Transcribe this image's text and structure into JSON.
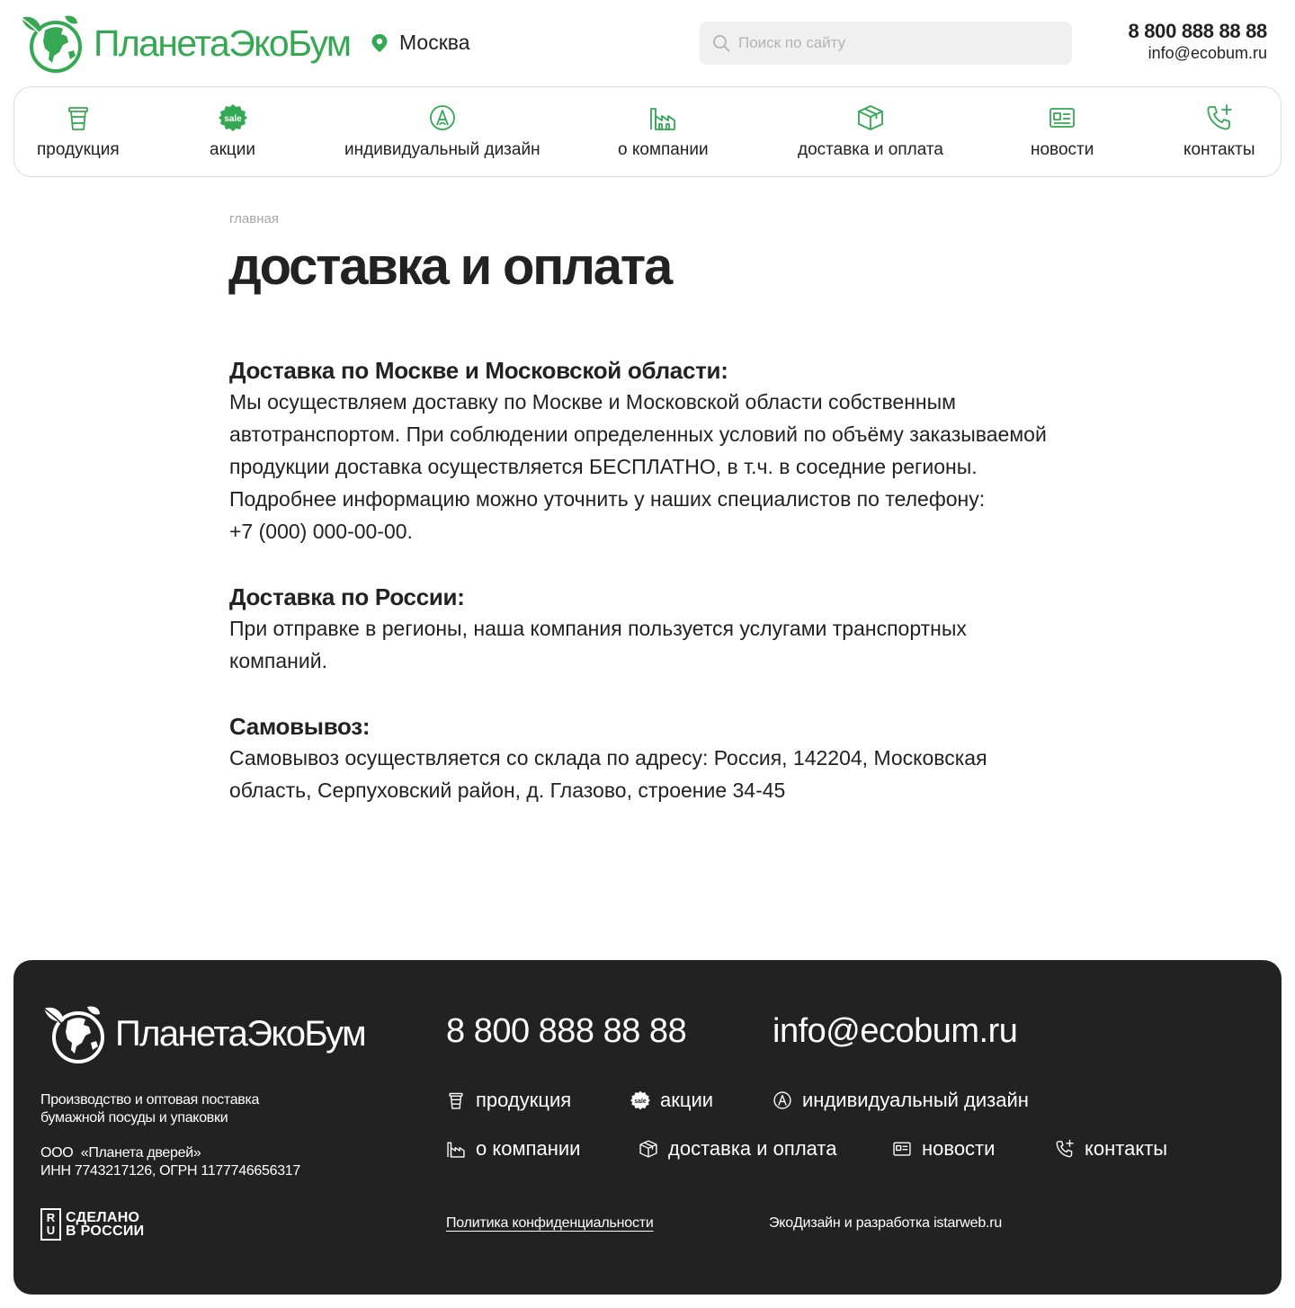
{
  "colors": {
    "brand_green": "#34a853",
    "footer_bg": "#222222",
    "text": "#222222"
  },
  "header": {
    "logo_text": "ПланетаЭкоБум",
    "city": "Москва",
    "search_placeholder": "Поиск по сайту",
    "phone": "8 800 888 88 88",
    "email": "info@ecobum.ru"
  },
  "nav": {
    "items": [
      {
        "label": "продукция",
        "icon": "cup-icon"
      },
      {
        "label": "акции",
        "icon": "sale-badge-icon"
      },
      {
        "label": "индивидуальный дизайн",
        "icon": "design-icon"
      },
      {
        "label": "о компании",
        "icon": "factory-icon"
      },
      {
        "label": "доставка и оплата",
        "icon": "box-icon"
      },
      {
        "label": "новости",
        "icon": "newspaper-icon"
      },
      {
        "label": "контакты",
        "icon": "phone-plus-icon"
      }
    ],
    "sale_badge_text": "sale"
  },
  "breadcrumb": {
    "home": "главная"
  },
  "page": {
    "title": "доставка и оплата",
    "sections": [
      {
        "heading": "Доставка по Москве и Московской области:",
        "paragraphs": [
          "Мы осуществляем доставку по Москве и Московской области собственным автотранспортом. При соблюдении определенных условий по объёму заказываемой продукции доставка осуществляется БЕСПЛАТНО, в т.ч. в соседние регионы.",
          "Подробнее информацию можно уточнить у наших специалистов по телефону:",
          "+7 (000) 000-00-00."
        ]
      },
      {
        "heading": "Доставка по России:",
        "paragraphs": [
          "При отправке в регионы, наша компания пользуется услугами транспортных компаний."
        ]
      },
      {
        "heading": "Самовывоз:",
        "paragraphs": [
          "Самовывоз осуществляется со склада по адресу: Россия, 142204, Московская область, Серпуховский район, д. Глазово, строение 34-45"
        ]
      }
    ]
  },
  "footer": {
    "logo_text": "ПланетаЭкоБум",
    "description_line1": "Производство и оптовая поставка",
    "description_line2": "бумажной посуды и упаковки",
    "company_line1": "ООО  «Планета дверей»",
    "company_line2": "ИНН 7743217126, ОГРН 1177746656317",
    "made_in_box_top": "R",
    "made_in_box_bottom": "U",
    "made_in_line1": "СДЕЛАНО",
    "made_in_line2": "В РОССИИ",
    "phone": "8 800 888 88 88",
    "email": "info@ecobum.ru",
    "nav": [
      {
        "label": "продукция",
        "icon": "cup-icon"
      },
      {
        "label": "акции",
        "icon": "sale-badge-icon"
      },
      {
        "label": "индивидуальный дизайн",
        "icon": "design-icon"
      },
      {
        "label": "о компании",
        "icon": "factory-icon"
      },
      {
        "label": "доставка и оплата",
        "icon": "box-icon"
      },
      {
        "label": "новости",
        "icon": "newspaper-icon"
      },
      {
        "label": "контакты",
        "icon": "phone-plus-icon"
      }
    ],
    "privacy": "Политика конфиденциальности",
    "developer": "ЭкоДизайн и разработка istarweb.ru"
  }
}
